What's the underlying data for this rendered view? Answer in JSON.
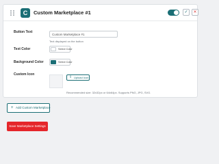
{
  "header": {
    "title": "Custom Marketplace #1",
    "app_icon_glyph": "C",
    "toggle_state": "on",
    "action_icon_glyph": "✓",
    "close_icon_glyph": "✕"
  },
  "form": {
    "button_text": {
      "label": "Button Text",
      "value": "Custom Marketplace #1",
      "hint": "Text displayed on the button"
    },
    "text_color": {
      "label": "Text Color",
      "button_label": "Select Color",
      "swatch": "#ffffff"
    },
    "background_color": {
      "label": "Background Color",
      "button_label": "Select Color",
      "swatch": "#1a6e75"
    },
    "custom_icon": {
      "label": "Custom Icon",
      "upload_label": "Upload Icon",
      "hint": "Recommended size: 32x32px or 64x64px. Supports PNG, JPG, SVG."
    }
  },
  "actions": {
    "add_label": "Add Custom Marketplace",
    "add_icon": "+",
    "save_label": "Save Marketplace Settings"
  },
  "colors": {
    "accent": "#1a6e75",
    "danger": "#e5262a"
  }
}
